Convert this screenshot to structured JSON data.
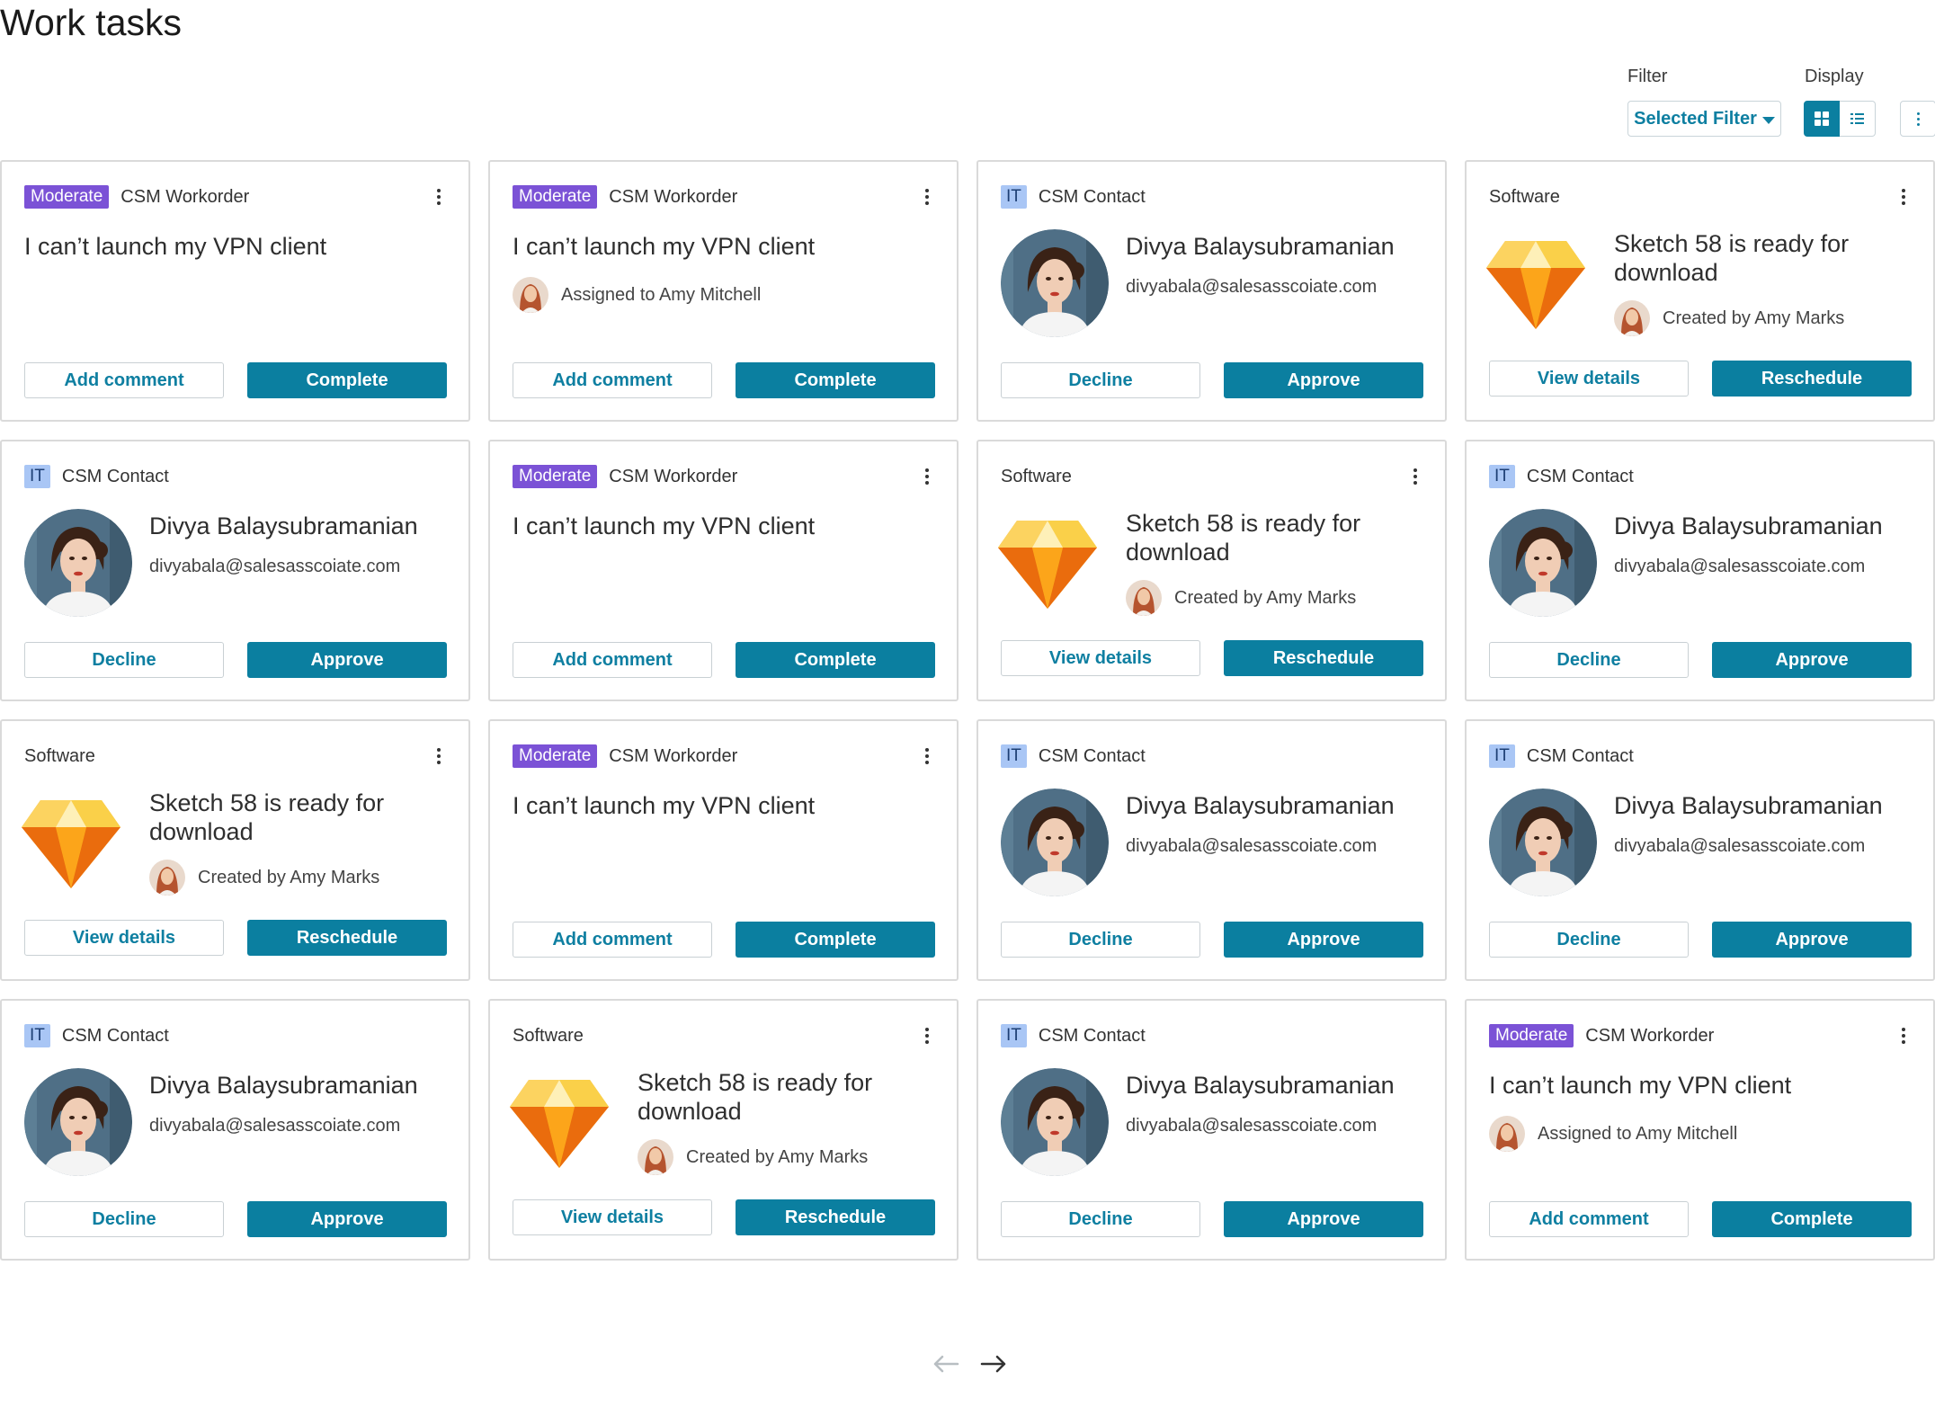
{
  "page": {
    "title": "Work tasks"
  },
  "toolbar": {
    "filter_label": "Filter",
    "filter_value": "Selected Filter",
    "display_label": "Display",
    "display_mode": "grid"
  },
  "colors": {
    "accent": "#0b7fa0",
    "moderate_badge": "#7b52d6",
    "it_badge": "#a9c6f5",
    "card_border": "#dadada"
  },
  "cards": [
    {
      "kind": "workorder",
      "badge": "Moderate",
      "type": "CSM Workorder",
      "title": "I can’t launch my VPN client",
      "subtitle": "",
      "secondary": "Add comment",
      "primary": "Complete"
    },
    {
      "kind": "workorder",
      "badge": "Moderate",
      "type": "CSM Workorder",
      "title": "I can’t launch my VPN client",
      "subtitle": "Assigned to Amy Mitchell",
      "secondary": "Add comment",
      "primary": "Complete"
    },
    {
      "kind": "contact",
      "badge": "IT",
      "type": "CSM Contact",
      "title": "Divya Balaysubramanian",
      "subtitle": "divyabala@salesasscoiate.com",
      "secondary": "Decline",
      "primary": "Approve"
    },
    {
      "kind": "software",
      "badge": "",
      "type": "Software",
      "title": "Sketch 58 is ready for download",
      "subtitle": "Created by Amy Marks",
      "secondary": "View details",
      "primary": "Reschedule"
    },
    {
      "kind": "contact",
      "badge": "IT",
      "type": "CSM Contact",
      "title": "Divya Balaysubramanian",
      "subtitle": "divyabala@salesasscoiate.com",
      "secondary": "Decline",
      "primary": "Approve"
    },
    {
      "kind": "workorder",
      "badge": "Moderate",
      "type": "CSM Workorder",
      "title": "I can’t launch my VPN client",
      "subtitle": "",
      "secondary": "Add comment",
      "primary": "Complete"
    },
    {
      "kind": "software",
      "badge": "",
      "type": "Software",
      "title": "Sketch 58 is ready for download",
      "subtitle": "Created by Amy Marks",
      "secondary": "View details",
      "primary": "Reschedule"
    },
    {
      "kind": "contact",
      "badge": "IT",
      "type": "CSM Contact",
      "title": "Divya Balaysubramanian",
      "subtitle": "divyabala@salesasscoiate.com",
      "secondary": "Decline",
      "primary": "Approve"
    },
    {
      "kind": "software",
      "badge": "",
      "type": "Software",
      "title": "Sketch 58 is ready for download",
      "subtitle": "Created by Amy Marks",
      "secondary": "View details",
      "primary": "Reschedule"
    },
    {
      "kind": "workorder",
      "badge": "Moderate",
      "type": "CSM Workorder",
      "title": "I can’t launch my VPN client",
      "subtitle": "",
      "secondary": "Add comment",
      "primary": "Complete"
    },
    {
      "kind": "contact",
      "badge": "IT",
      "type": "CSM Contact",
      "title": "Divya Balaysubramanian",
      "subtitle": "divyabala@salesasscoiate.com",
      "secondary": "Decline",
      "primary": "Approve"
    },
    {
      "kind": "contact",
      "badge": "IT",
      "type": "CSM Contact",
      "title": "Divya Balaysubramanian",
      "subtitle": "divyabala@salesasscoiate.com",
      "secondary": "Decline",
      "primary": "Approve"
    },
    {
      "kind": "contact",
      "badge": "IT",
      "type": "CSM Contact",
      "title": "Divya Balaysubramanian",
      "subtitle": "divyabala@salesasscoiate.com",
      "secondary": "Decline",
      "primary": "Approve"
    },
    {
      "kind": "software",
      "badge": "",
      "type": "Software",
      "title": "Sketch 58 is ready for download",
      "subtitle": "Created by Amy Marks",
      "secondary": "View details",
      "primary": "Reschedule"
    },
    {
      "kind": "contact",
      "badge": "IT",
      "type": "CSM Contact",
      "title": "Divya Balaysubramanian",
      "subtitle": "divyabala@salesasscoiate.com",
      "secondary": "Decline",
      "primary": "Approve"
    },
    {
      "kind": "workorder",
      "badge": "Moderate",
      "type": "CSM Workorder",
      "title": "I can’t launch my VPN client",
      "subtitle": "Assigned to Amy Mitchell",
      "secondary": "Add comment",
      "primary": "Complete"
    }
  ],
  "pagination": {
    "prev_icon": "arrow-left-icon",
    "next_icon": "arrow-right-icon"
  }
}
